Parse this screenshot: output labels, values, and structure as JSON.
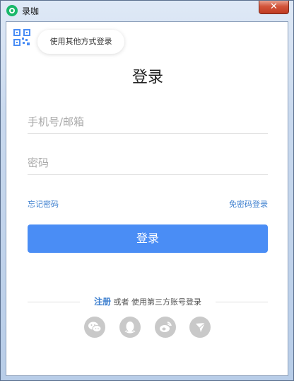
{
  "window": {
    "title": "录咖",
    "close_label": "✕"
  },
  "qr": {
    "tooltip": "使用其他方式登录"
  },
  "login": {
    "title": "登录",
    "phone_placeholder": "手机号/邮箱",
    "password_placeholder": "密码",
    "forgot_label": "忘记密码",
    "no_password_label": "免密码登录",
    "submit_label": "登录"
  },
  "third_party": {
    "register_label": "注册",
    "or_text": " 或者 使用第三方账号登录",
    "icons": [
      "wechat-icon",
      "qq-icon",
      "weibo-icon",
      "other-login-icon"
    ]
  },
  "colors": {
    "accent": "#4a8df5",
    "link": "#3d7fcf",
    "app_icon": "#19b86a",
    "social_bg": "#c9c9c9"
  }
}
